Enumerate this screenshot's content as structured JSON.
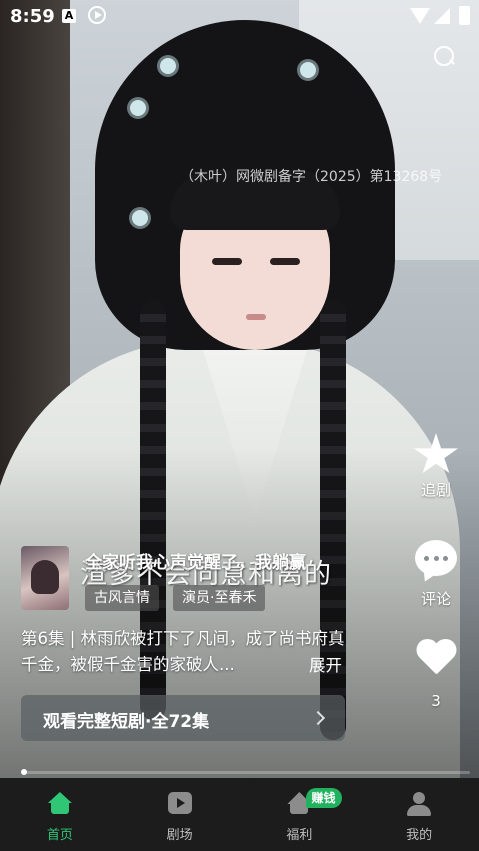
{
  "status_bar": {
    "time": "8:59",
    "app_icon_text": "A"
  },
  "video": {
    "license_text": "（木叶）网微剧备字（2025）第13268号",
    "subtitle": "渣爹不会同意和离的",
    "progress": 0.005
  },
  "actions": {
    "follow_label": "追剧",
    "comment_label": "评论",
    "like_count": "3"
  },
  "drama": {
    "title": "全家听我心声觉醒了，我躺赢",
    "tags": [
      "古风言情",
      "演员·至春禾"
    ],
    "description": "第6集 | 林雨欣被打下了凡间，成了尚书府真千金，被假千金害的家破人...",
    "expand_label": "展开",
    "watch_button_label": "观看完整短剧·全72集"
  },
  "nav": {
    "items": [
      {
        "label": "首页",
        "icon": "home-icon",
        "active": true
      },
      {
        "label": "剧场",
        "icon": "play-icon",
        "active": false
      },
      {
        "label": "福利",
        "icon": "welfare-icon",
        "active": false
      },
      {
        "label": "我的",
        "icon": "user-icon",
        "active": false
      }
    ],
    "badge": "赚钱"
  },
  "colors": {
    "accent": "#2fc676",
    "nav_background": "#1c1c1c",
    "badge": "#21b15f"
  }
}
